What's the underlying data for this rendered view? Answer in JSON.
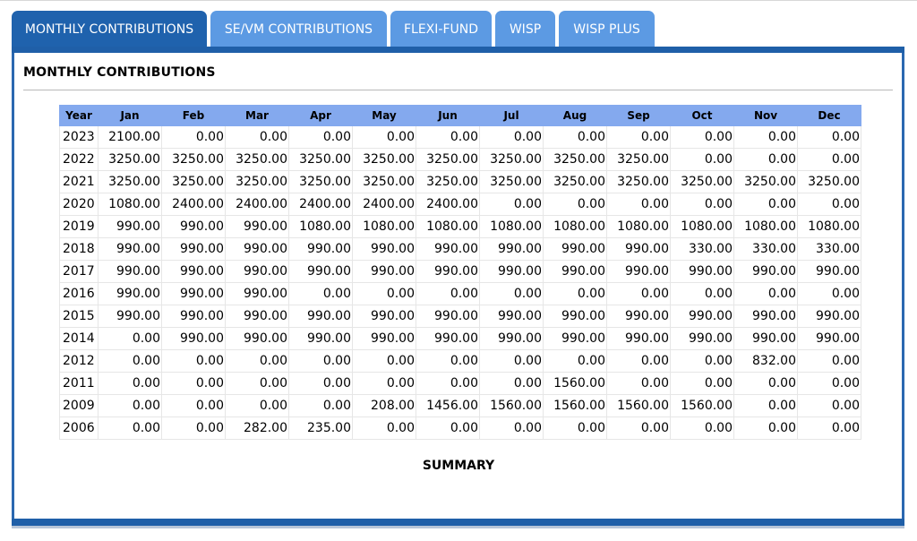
{
  "tabs": [
    {
      "label": "MONTHLY CONTRIBUTIONS",
      "active": true
    },
    {
      "label": "SE/VM CONTRIBUTIONS",
      "active": false
    },
    {
      "label": "FLEXI-FUND",
      "active": false
    },
    {
      "label": "WISP",
      "active": false
    },
    {
      "label": "WISP PLUS",
      "active": false
    }
  ],
  "section_title": "MONTHLY CONTRIBUTIONS",
  "table": {
    "headers": [
      "Year",
      "Jan",
      "Feb",
      "Mar",
      "Apr",
      "May",
      "Jun",
      "Jul",
      "Aug",
      "Sep",
      "Oct",
      "Nov",
      "Dec"
    ],
    "rows": [
      [
        "2023",
        "2100.00",
        "0.00",
        "0.00",
        "0.00",
        "0.00",
        "0.00",
        "0.00",
        "0.00",
        "0.00",
        "0.00",
        "0.00",
        "0.00"
      ],
      [
        "2022",
        "3250.00",
        "3250.00",
        "3250.00",
        "3250.00",
        "3250.00",
        "3250.00",
        "3250.00",
        "3250.00",
        "3250.00",
        "0.00",
        "0.00",
        "0.00"
      ],
      [
        "2021",
        "3250.00",
        "3250.00",
        "3250.00",
        "3250.00",
        "3250.00",
        "3250.00",
        "3250.00",
        "3250.00",
        "3250.00",
        "3250.00",
        "3250.00",
        "3250.00"
      ],
      [
        "2020",
        "1080.00",
        "2400.00",
        "2400.00",
        "2400.00",
        "2400.00",
        "2400.00",
        "0.00",
        "0.00",
        "0.00",
        "0.00",
        "0.00",
        "0.00"
      ],
      [
        "2019",
        "990.00",
        "990.00",
        "990.00",
        "1080.00",
        "1080.00",
        "1080.00",
        "1080.00",
        "1080.00",
        "1080.00",
        "1080.00",
        "1080.00",
        "1080.00"
      ],
      [
        "2018",
        "990.00",
        "990.00",
        "990.00",
        "990.00",
        "990.00",
        "990.00",
        "990.00",
        "990.00",
        "990.00",
        "330.00",
        "330.00",
        "330.00"
      ],
      [
        "2017",
        "990.00",
        "990.00",
        "990.00",
        "990.00",
        "990.00",
        "990.00",
        "990.00",
        "990.00",
        "990.00",
        "990.00",
        "990.00",
        "990.00"
      ],
      [
        "2016",
        "990.00",
        "990.00",
        "990.00",
        "0.00",
        "0.00",
        "0.00",
        "0.00",
        "0.00",
        "0.00",
        "0.00",
        "0.00",
        "0.00"
      ],
      [
        "2015",
        "990.00",
        "990.00",
        "990.00",
        "990.00",
        "990.00",
        "990.00",
        "990.00",
        "990.00",
        "990.00",
        "990.00",
        "990.00",
        "990.00"
      ],
      [
        "2014",
        "0.00",
        "990.00",
        "990.00",
        "990.00",
        "990.00",
        "990.00",
        "990.00",
        "990.00",
        "990.00",
        "990.00",
        "990.00",
        "990.00"
      ],
      [
        "2012",
        "0.00",
        "0.00",
        "0.00",
        "0.00",
        "0.00",
        "0.00",
        "0.00",
        "0.00",
        "0.00",
        "0.00",
        "832.00",
        "0.00"
      ],
      [
        "2011",
        "0.00",
        "0.00",
        "0.00",
        "0.00",
        "0.00",
        "0.00",
        "0.00",
        "1560.00",
        "0.00",
        "0.00",
        "0.00",
        "0.00"
      ],
      [
        "2009",
        "0.00",
        "0.00",
        "0.00",
        "0.00",
        "208.00",
        "1456.00",
        "1560.00",
        "1560.00",
        "1560.00",
        "1560.00",
        "0.00",
        "0.00"
      ],
      [
        "2006",
        "0.00",
        "0.00",
        "282.00",
        "235.00",
        "0.00",
        "0.00",
        "0.00",
        "0.00",
        "0.00",
        "0.00",
        "0.00",
        "0.00"
      ]
    ]
  },
  "summary_label": "SUMMARY",
  "colors": {
    "active_tab": "#1f62ad",
    "inactive_tab": "#5c9ae3",
    "panel_border": "#1f5fa8",
    "table_header_bg": "#84a9ee"
  }
}
